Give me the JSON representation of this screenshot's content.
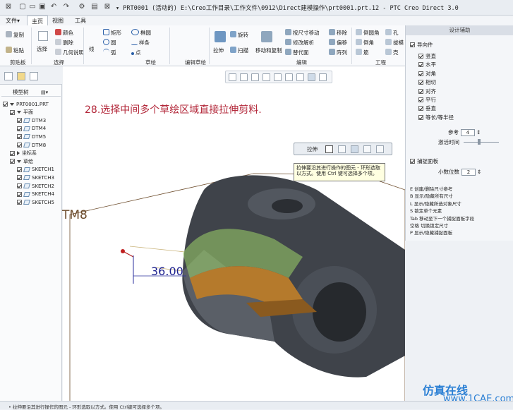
{
  "window": {
    "title": "▾ PRT0001 (活动的) E:\\Creo工作目录\\工作文件\\0912\\Direct建模操作\\prt0001.prt.12 - PTC Creo Direct 3.0"
  },
  "menu": {
    "file": "文件▾",
    "home": "主页",
    "view": "视图",
    "tools": "工具"
  },
  "ribbon": {
    "clipboard": {
      "copy": "复制",
      "paste": "粘贴",
      "label": "剪贴板"
    },
    "select": {
      "select": "选择",
      "color": "颜色",
      "delete": "删除",
      "hide": "几何说明",
      "label": "选择"
    },
    "sketch": {
      "line": "线",
      "rectangle": "矩形",
      "ellipse": "椭圆",
      "circle": "圆",
      "spline": "样条",
      "arc": "弧",
      "point": "点",
      "label": "草绘"
    },
    "edit_sketch": {
      "label": "编辑草绘"
    },
    "edit": {
      "extrude": "拉伸",
      "revolve": "旋转",
      "sweep": "扫描",
      "move_copy": "移动和复制",
      "offset_move": "按尺寸移动",
      "modify_analysis": "修改解析",
      "replace": "替代面",
      "move": "移除",
      "offset": "偏移",
      "pattern": "阵列",
      "label": "编辑"
    },
    "engineering": {
      "round": "倒圆角",
      "chamfer": "倒角",
      "shell": "壳",
      "hole": "孔",
      "draft": "拔模",
      "rib": "筋",
      "label": "工程"
    }
  },
  "model_tree": {
    "header": "模型树",
    "items": [
      {
        "label": "PRT0001.PRT",
        "level": 0,
        "expanded": true
      },
      {
        "label": "平面",
        "level": 1,
        "expanded": true
      },
      {
        "label": "DTM3",
        "level": 2
      },
      {
        "label": "DTM4",
        "level": 2
      },
      {
        "label": "DTM5",
        "level": 2
      },
      {
        "label": "DTM8",
        "level": 2
      },
      {
        "label": "坐标系",
        "level": 1,
        "expanded": false
      },
      {
        "label": "草绘",
        "level": 1,
        "expanded": true
      },
      {
        "label": "SKETCH1",
        "level": 2
      },
      {
        "label": "SKETCH3",
        "level": 2
      },
      {
        "label": "SKETCH2",
        "level": 2
      },
      {
        "label": "SKETCH4",
        "level": 2
      },
      {
        "label": "SKETCH5",
        "level": 2
      }
    ]
  },
  "design_assistant": {
    "title": "设计辅助",
    "snap_section": "导向件",
    "options": [
      {
        "label": "竖直",
        "checked": true
      },
      {
        "label": "水平",
        "checked": true
      },
      {
        "label": "对角",
        "checked": true
      },
      {
        "label": "相切",
        "checked": true
      },
      {
        "label": "对齐",
        "checked": true
      },
      {
        "label": "平行",
        "checked": true
      },
      {
        "label": "垂直",
        "checked": true
      },
      {
        "label": "等长/等半径",
        "checked": true
      }
    ],
    "ref_label": "参考",
    "ref_value": "4",
    "delay_label": "激活时间",
    "sketch_plane": "捕捉面板",
    "decimals_label": "小数位数",
    "decimals_value": "2",
    "shortcuts": [
      "E 创建/删除尺寸参考",
      "B 显示/隐藏所有尺寸",
      "L 显示/隐藏所选对象尺寸",
      "S 锁定单个元素",
      "Tab 移动至下一个捕捉面板字段",
      "空格 切换锁定尺寸",
      "P 显示/隐藏捕捉面板"
    ]
  },
  "float_toolbar": {
    "label": "拉伸"
  },
  "tooltip": {
    "text": "拉伸要沿其进行操作的图元 - 环形选取以方式。使用 Ctrl 键可选择多个项。"
  },
  "annotation": {
    "text": "28.选择中间多个草绘区域直接拉伸剪料."
  },
  "dimension": {
    "value": "36.00"
  },
  "datum": {
    "label": "TM8"
  },
  "status": {
    "text": "• 拉伸要沿其进行操作的图元 - 环形选取以方式。使用 Ctrl键可选择多个项。"
  },
  "watermark": {
    "line1": "仿真在线",
    "line2": "www.1CAE.com"
  },
  "colors": {
    "annotation": "#b3283a",
    "dimension": "#1b1f8f",
    "part_body": "#3f434a",
    "selection": "#9ed36a",
    "cut_face": "#b57a2c"
  }
}
